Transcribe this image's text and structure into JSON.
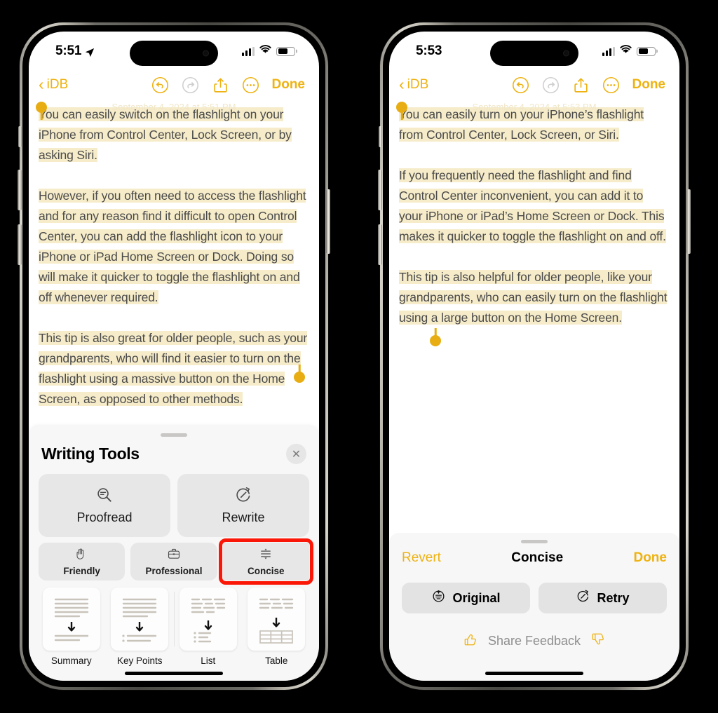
{
  "left_phone": {
    "status_bar": {
      "time": "5:51",
      "location_icon": "location-arrow-icon",
      "cellular_icon": "cellular-signal-icon",
      "cellular_bars_on": 3,
      "cellular_bars_total": 4,
      "wifi_icon": "wifi-icon",
      "battery_icon": "battery-icon",
      "battery_level_pct": 62
    },
    "nav": {
      "back_label": "iDB",
      "undo_icon": "undo-icon",
      "redo_icon": "redo-icon",
      "share_icon": "share-icon",
      "more_icon": "more-ellipsis-icon",
      "done_label": "Done"
    },
    "document": {
      "date_line": "September 4, 2024 at 5:51 PM",
      "paragraphs": [
        "You can easily switch on the flashlight on your iPhone from Control Center, Lock Screen, or by asking Siri.",
        "However, if you often need to access the flashlight and for any reason find it difficult to open Control Center, you can add the flashlight icon to your iPhone or iPad Home Screen or Dock. Doing so will make it quicker to toggle the flashlight on and off whenever required.",
        "This tip is also great for older people, such as your grandparents, who will find it easier to turn on the flashlight using a massive button on the Home Screen, as opposed to other methods."
      ]
    },
    "writing_tools": {
      "title": "Writing Tools",
      "close_icon": "close-icon",
      "grabber": "sheet-grabber",
      "primary_actions": [
        {
          "label": "Proofread",
          "icon": "proofread-magnifier-icon"
        },
        {
          "label": "Rewrite",
          "icon": "rewrite-clock-icon"
        }
      ],
      "tone_actions": [
        {
          "label": "Friendly",
          "icon": "waving-hand-icon",
          "highlighted": false
        },
        {
          "label": "Professional",
          "icon": "briefcase-icon",
          "highlighted": false
        },
        {
          "label": "Concise",
          "icon": "compress-arrows-icon",
          "highlighted": true
        }
      ],
      "format_actions": [
        {
          "label": "Summary",
          "icon": "summary-thumbnail-icon"
        },
        {
          "label": "Key Points",
          "icon": "key-points-thumbnail-icon"
        },
        {
          "label": "List",
          "icon": "list-thumbnail-icon"
        },
        {
          "label": "Table",
          "icon": "table-thumbnail-icon"
        }
      ],
      "highlight_color": "#fb1707"
    }
  },
  "right_phone": {
    "status_bar": {
      "time": "5:53",
      "cellular_icon": "cellular-signal-icon",
      "cellular_bars_on": 3,
      "cellular_bars_total": 4,
      "wifi_icon": "wifi-icon",
      "battery_icon": "battery-icon",
      "battery_level_pct": 62
    },
    "nav": {
      "back_label": "iDB",
      "undo_icon": "undo-icon",
      "redo_icon": "redo-icon",
      "share_icon": "share-icon",
      "more_icon": "more-ellipsis-icon",
      "done_label": "Done"
    },
    "document": {
      "date_line": "September 4, 2024 at 5:53 PM",
      "paragraphs": [
        "You can easily turn on your iPhone’s flashlight from Control Center, Lock Screen, or Siri.",
        "If you frequently need the flashlight and find Control Center inconvenient, you can add it to your iPhone or iPad’s Home Screen or Dock. This makes it quicker to toggle the flashlight on and off.",
        "This tip is also helpful for older people, like your grandparents, who can easily turn on the flashlight using a large button on the Home Screen."
      ]
    },
    "result_sheet": {
      "revert_label": "Revert",
      "title": "Concise",
      "done_label": "Done",
      "actions": [
        {
          "label": "Original",
          "icon": "original-document-icon"
        },
        {
          "label": "Retry",
          "icon": "retry-clock-icon"
        }
      ],
      "feedback_label": "Share Feedback",
      "thumbs_up_icon": "thumbs-up-icon",
      "thumbs_down_icon": "thumbs-down-icon"
    }
  },
  "theme": {
    "accent_yellow": "#eeb211",
    "highlight_text_bg": "#f6ecca",
    "selection_handle": "#e8ad12",
    "sheet_bg": "#f7f7f7",
    "card_bg": "#e7e7e7",
    "page_bg": "#000000"
  }
}
